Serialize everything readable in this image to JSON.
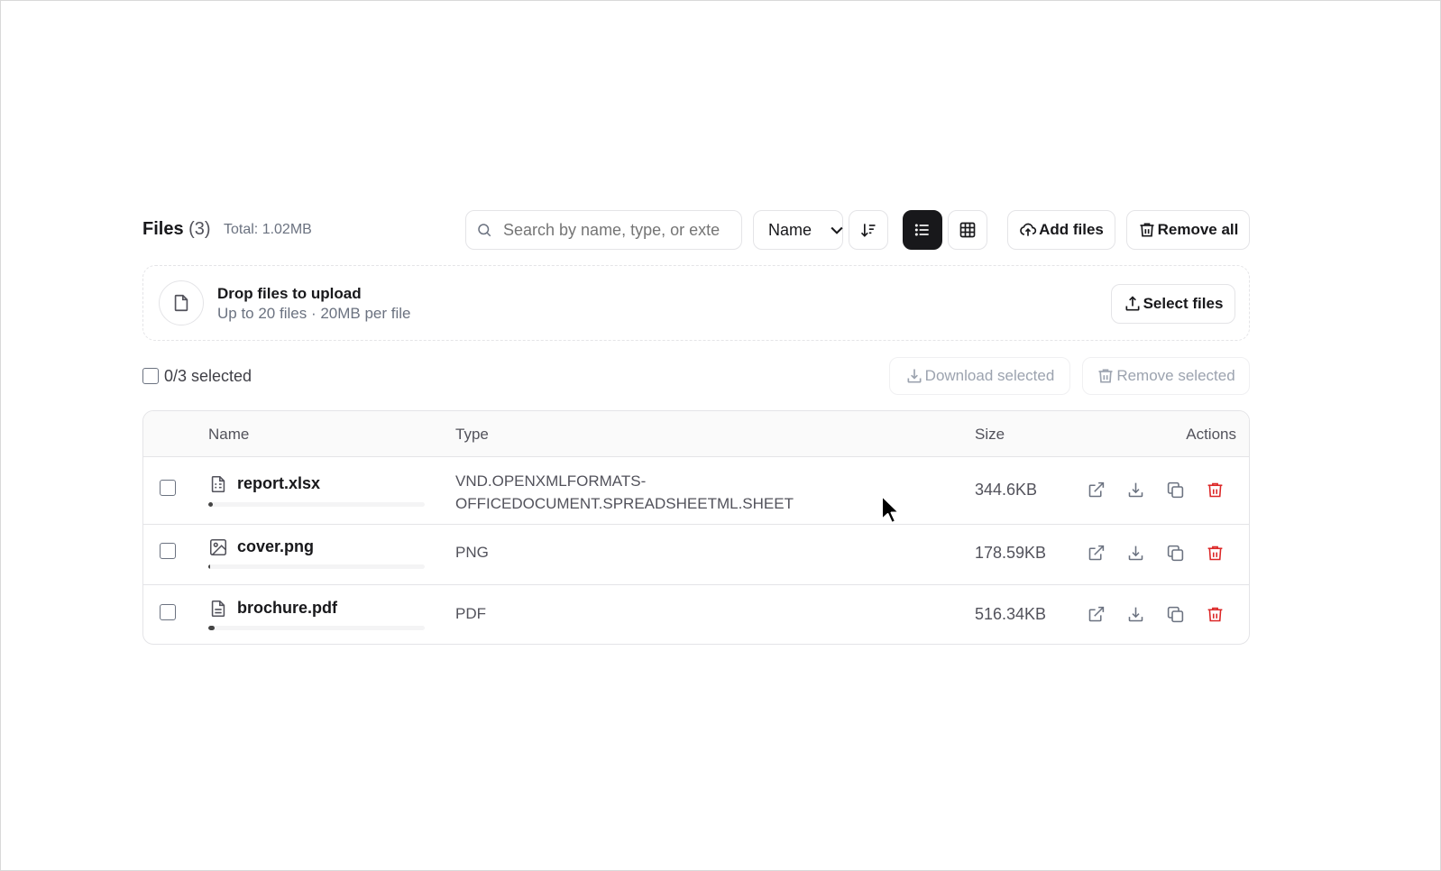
{
  "header": {
    "title": "Files",
    "count": "(3)",
    "total": "Total: 1.02MB"
  },
  "toolbar": {
    "search_placeholder": "Search by name, type, or extension",
    "sort_value": "Name",
    "add_label": "Add files",
    "remove_all_label": "Remove all"
  },
  "dropzone": {
    "title": "Drop files to upload",
    "subtitle": "Up to 20 files · 20MB per file",
    "select_label": "Select files"
  },
  "selection": {
    "count": "0/3 selected",
    "download_label": "Download selected",
    "remove_label": "Remove selected"
  },
  "table": {
    "columns": {
      "name": "Name",
      "type": "Type",
      "size": "Size",
      "actions": "Actions"
    },
    "rows": [
      {
        "name": "report.xlsx",
        "type_line1": "VND.OPENXMLFORMATS-",
        "type_line2": "OFFICEDOCUMENT.SPREADSHEETML.SHEET",
        "size": "344.6KB",
        "icon": "spreadsheet-file-icon",
        "progress": 0.02
      },
      {
        "name": "cover.png",
        "type_line1": "PNG",
        "type_line2": "",
        "size": "178.59KB",
        "icon": "image-file-icon",
        "progress": 0.01
      },
      {
        "name": "brochure.pdf",
        "type_line1": "PDF",
        "type_line2": "",
        "size": "516.34KB",
        "icon": "document-file-icon",
        "progress": 0.03
      }
    ]
  },
  "colors": {
    "accent": "#18181b",
    "danger": "#dc2626",
    "muted": "#6b7280",
    "border": "#e4e4e7"
  }
}
